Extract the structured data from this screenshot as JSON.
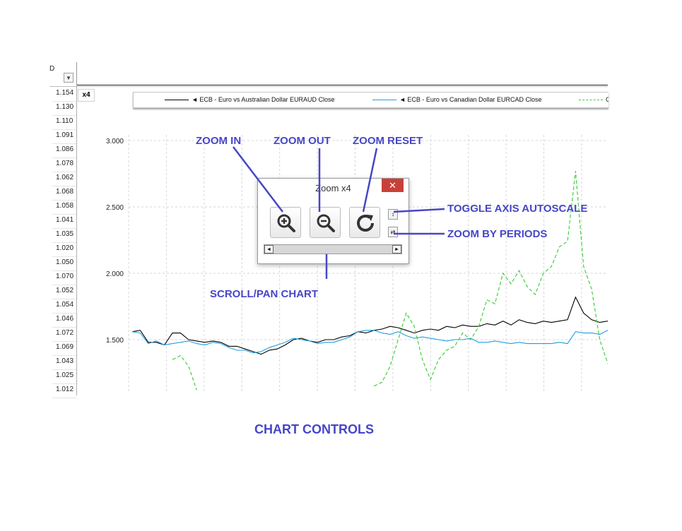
{
  "sheet": {
    "column_letter": "D",
    "filter_icon": "dropdown-arrow-icon",
    "cell_values": [
      "1.154",
      "1.130",
      "1.110",
      "1.091",
      "1.086",
      "1.078",
      "1.062",
      "1.068",
      "1.058",
      "1.041",
      "1.035",
      "1.020",
      "1.050",
      "1.070",
      "1.052",
      "1.054",
      "1.046",
      "1.072",
      "1.069",
      "1.043",
      "1.025",
      "1.012"
    ]
  },
  "chart": {
    "zoom_badge": "x4",
    "legend": [
      {
        "label": "◄ ECB - Euro  vs Australian Dollar EURAUD Close",
        "color": "#000000",
        "style": "solid"
      },
      {
        "label": "◄ ECB - Euro  vs Canadian Dollar EURCAD Close",
        "color": "#1f9fe0",
        "style": "solid"
      },
      {
        "label": "C",
        "color": "#33cc33",
        "style": "dashed"
      }
    ],
    "y_ticks": [
      "3.000",
      "2.500",
      "2.000",
      "1.500"
    ]
  },
  "chart_data": {
    "type": "line",
    "ylim": [
      1.12,
      3.08
    ],
    "grid": true,
    "legend_position": "top",
    "series": [
      {
        "name": "◄ ECB - Euro  vs Australian Dollar EURAUD Close",
        "color": "#000000",
        "values": [
          1.56,
          1.57,
          1.48,
          1.48,
          1.46,
          1.55,
          1.55,
          1.5,
          1.49,
          1.48,
          1.49,
          1.48,
          1.45,
          1.45,
          1.43,
          1.41,
          1.39,
          1.42,
          1.43,
          1.46,
          1.5,
          1.51,
          1.49,
          1.48,
          1.5,
          1.5,
          1.52,
          1.53,
          1.56,
          1.55,
          1.57,
          1.58,
          1.6,
          1.59,
          1.57,
          1.55,
          1.57,
          1.58,
          1.57,
          1.6,
          1.59,
          1.61,
          1.6,
          1.6,
          1.62,
          1.61,
          1.64,
          1.61,
          1.65,
          1.63,
          1.62,
          1.64,
          1.63,
          1.64,
          1.65,
          1.82,
          1.7,
          1.65,
          1.63,
          1.64
        ]
      },
      {
        "name": "◄ ECB - Euro  vs Canadian Dollar EURCAD Close",
        "color": "#1f9fe0",
        "values": [
          1.56,
          1.55,
          1.47,
          1.49,
          1.46,
          1.47,
          1.48,
          1.49,
          1.47,
          1.46,
          1.48,
          1.47,
          1.44,
          1.42,
          1.42,
          1.4,
          1.41,
          1.44,
          1.46,
          1.48,
          1.51,
          1.5,
          1.49,
          1.47,
          1.48,
          1.48,
          1.5,
          1.52,
          1.56,
          1.57,
          1.57,
          1.55,
          1.54,
          1.56,
          1.53,
          1.51,
          1.52,
          1.51,
          1.5,
          1.49,
          1.5,
          1.5,
          1.51,
          1.48,
          1.48,
          1.49,
          1.48,
          1.47,
          1.48,
          1.47,
          1.47,
          1.47,
          1.47,
          1.48,
          1.47,
          1.56,
          1.55,
          1.55,
          1.54,
          1.57
        ]
      },
      {
        "name": "C",
        "color": "#33cc33",
        "dashed": true,
        "values": [
          null,
          null,
          null,
          null,
          null,
          1.35,
          1.38,
          1.3,
          1.12,
          null,
          null,
          null,
          null,
          null,
          null,
          null,
          null,
          null,
          null,
          null,
          null,
          null,
          null,
          null,
          null,
          null,
          1.13,
          null,
          null,
          null,
          1.15,
          1.18,
          1.3,
          1.5,
          1.7,
          1.6,
          1.35,
          1.2,
          1.35,
          1.42,
          1.45,
          1.55,
          1.5,
          1.6,
          1.8,
          1.77,
          2.0,
          1.92,
          2.02,
          1.9,
          1.84,
          2.0,
          2.05,
          2.2,
          2.24,
          2.77,
          2.05,
          1.88,
          1.5,
          1.32
        ]
      }
    ]
  },
  "zoom_dialog": {
    "title": "Zoom x4",
    "close_label": "✕",
    "buttons": {
      "zoom_in": "zoom-in-icon",
      "zoom_out": "zoom-out-icon",
      "reset": "refresh-icon"
    },
    "autoscale_label": "↕",
    "periods_label": "⇄",
    "scroll_left": "◄",
    "scroll_right": "►"
  },
  "annotations": {
    "zoom_in": "ZOOM IN",
    "zoom_out": "ZOOM OUT",
    "zoom_reset": "ZOOM RESET",
    "toggle_autoscale": "TOGGLE  AXIS AUTOSCALE",
    "zoom_by_periods": "ZOOM BY PERIODS",
    "scroll_pan": "SCROLL/PAN CHART",
    "caption": "CHART CONTROLS"
  }
}
